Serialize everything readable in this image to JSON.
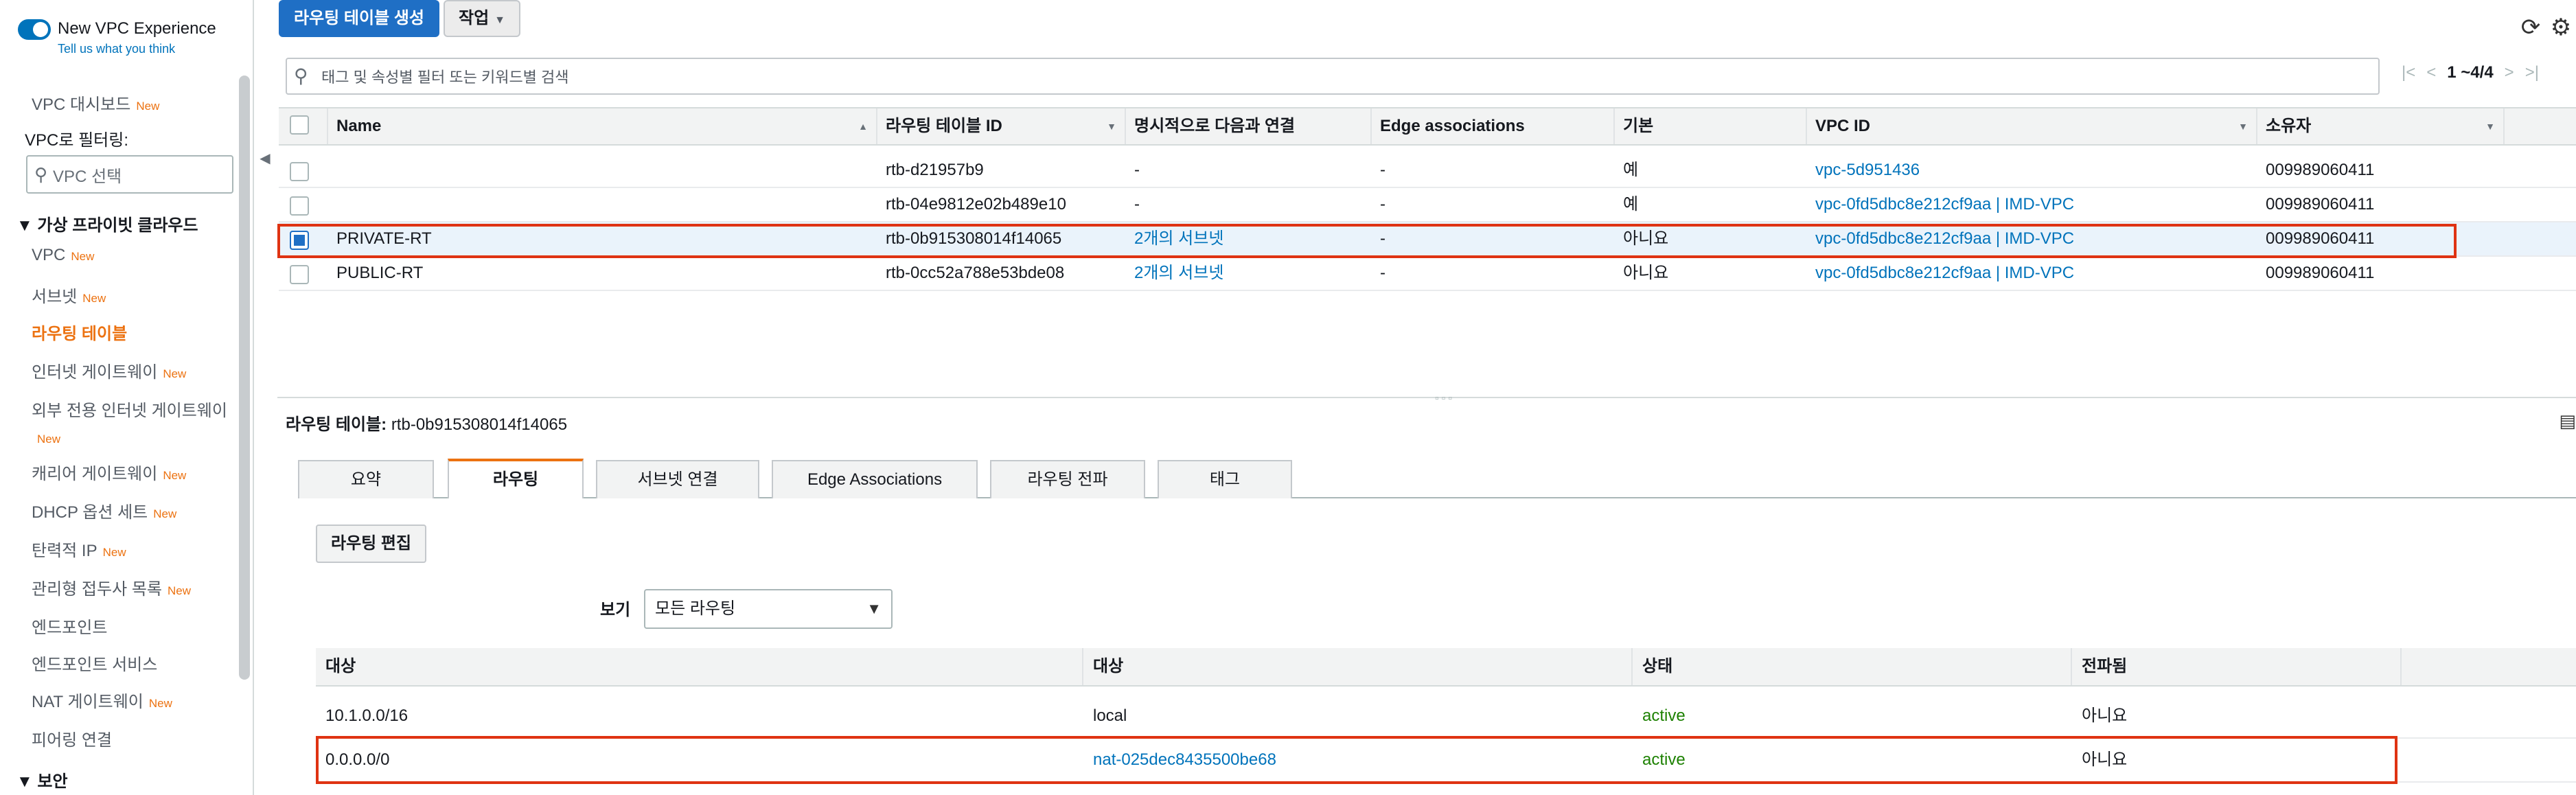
{
  "sidebar": {
    "new_vpc_experience": "New VPC Experience",
    "tell_us": "Tell us what you think",
    "dashboard": "VPC 대시보드",
    "new_badge": "New",
    "filter_label": "VPC로 필터링:",
    "filter_placeholder": "VPC 선택",
    "section_vpc": "▼ 가상 프라이빗 클라우드",
    "items": [
      {
        "label": "VPC",
        "new": "New"
      },
      {
        "label": "서브넷",
        "new": "New"
      },
      {
        "label": "라우팅 테이블",
        "new": ""
      },
      {
        "label": "인터넷 게이트웨이",
        "new": "New"
      },
      {
        "label": "외부 전용 인터넷 게이트웨이",
        "new": ""
      },
      {
        "label": "New",
        "new": ""
      },
      {
        "label": "캐리어 게이트웨이",
        "new": "New"
      },
      {
        "label": "DHCP 옵션 세트",
        "new": "New"
      },
      {
        "label": "탄력적 IP",
        "new": "New"
      },
      {
        "label": "관리형 접두사 목록",
        "new": "New"
      },
      {
        "label": "엔드포인트",
        "new": ""
      },
      {
        "label": "엔드포인트 서비스",
        "new": ""
      },
      {
        "label": "NAT 게이트웨이",
        "new": "New"
      },
      {
        "label": "피어링 연결",
        "new": ""
      }
    ],
    "section_security": "▼ 보안"
  },
  "toolbar": {
    "create_label": "라우팅 테이블 생성",
    "actions_label": "작업",
    "refresh_icon": "refresh-icon",
    "settings_icon": "gear-icon"
  },
  "filter": {
    "placeholder": "태그 및 속성별 필터 또는 키워드별 검색"
  },
  "pager": {
    "count": "1 ~4/4"
  },
  "table": {
    "columns": [
      "Name",
      "라우팅 테이블 ID",
      "명시적으로 다음과 연결",
      "Edge associations",
      "기본",
      "VPC ID",
      "소유자"
    ],
    "rows": [
      {
        "name": "",
        "id": "rtb-d21957b9",
        "explicit": "-",
        "edge": "-",
        "main": "예",
        "vpc": "vpc-5d951436",
        "owner": "009989060411"
      },
      {
        "name": "",
        "id": "rtb-04e9812e02b489e10",
        "explicit": "-",
        "edge": "-",
        "main": "예",
        "vpc": "vpc-0fd5dbc8e212cf9aa | IMD-VPC",
        "owner": "009989060411"
      },
      {
        "name": "PRIVATE-RT",
        "id": "rtb-0b915308014f14065",
        "explicit": "2개의 서브넷",
        "edge": "-",
        "main": "아니요",
        "vpc": "vpc-0fd5dbc8e212cf9aa | IMD-VPC",
        "owner": "009989060411"
      },
      {
        "name": "PUBLIC-RT",
        "id": "rtb-0cc52a788e53bde08",
        "explicit": "2개의 서브넷",
        "edge": "-",
        "main": "아니요",
        "vpc": "vpc-0fd5dbc8e212cf9aa | IMD-VPC",
        "owner": "009989060411"
      }
    ]
  },
  "detail": {
    "title_label": "라우팅 테이블:",
    "title_value": "rtb-0b915308014f14065",
    "tabs": [
      "요약",
      "라우팅",
      "서브넷 연결",
      "Edge Associations",
      "라우팅 전파",
      "태그"
    ],
    "edit_label": "라우팅 편집",
    "view_label": "보기",
    "view_value": "모든 라우팅",
    "columns": [
      "대상",
      "대상",
      "상태",
      "전파됨"
    ],
    "routes": [
      {
        "dest": "10.1.0.0/16",
        "target": "local",
        "status": "active",
        "propagated": "아니요"
      },
      {
        "dest": "0.0.0.0/0",
        "target": "nat-025dec8435500be68",
        "status": "active",
        "propagated": "아니요"
      }
    ]
  }
}
